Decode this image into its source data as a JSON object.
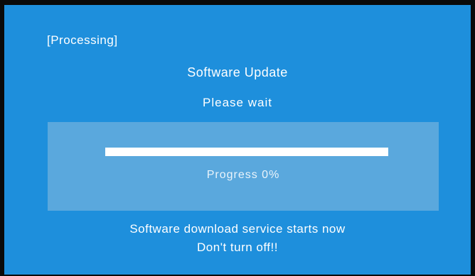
{
  "status": "[Processing]",
  "title": "Software Update",
  "subtitle": "Please wait",
  "progress": {
    "label": "Progress  0%",
    "value": 0
  },
  "footer": {
    "line1": "Software download service starts now",
    "line2": "Don't turn off!!"
  },
  "colors": {
    "background": "#1e8fdc",
    "panel": "#5aa8dd",
    "track": "#ffffff",
    "text": "#ffffff"
  }
}
